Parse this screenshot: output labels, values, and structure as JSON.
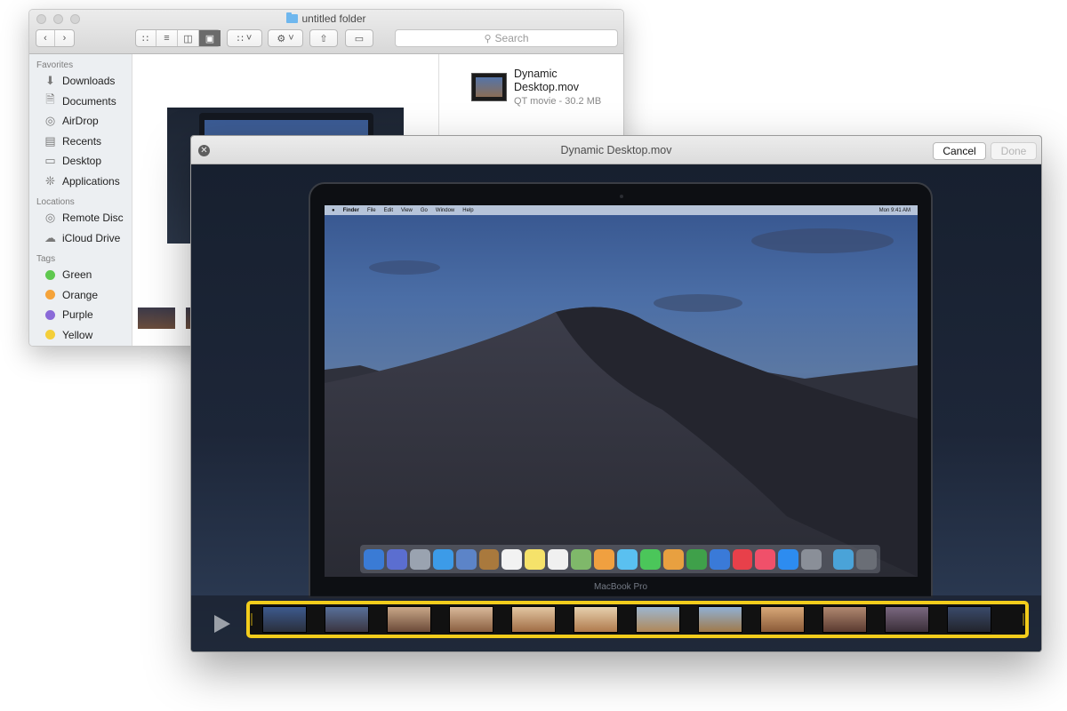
{
  "finder": {
    "title": "untitled folder",
    "search_placeholder": "Search",
    "sidebar": {
      "favorites_heading": "Favorites",
      "favorites": [
        {
          "label": "Downloads",
          "icon": "downloads-icon"
        },
        {
          "label": "Documents",
          "icon": "documents-icon"
        },
        {
          "label": "AirDrop",
          "icon": "airdrop-icon"
        },
        {
          "label": "Recents",
          "icon": "recents-icon"
        },
        {
          "label": "Desktop",
          "icon": "desktop-icon"
        },
        {
          "label": "Applications",
          "icon": "applications-icon"
        }
      ],
      "locations_heading": "Locations",
      "locations": [
        {
          "label": "Remote Disc",
          "icon": "disc-icon"
        },
        {
          "label": "iCloud Drive",
          "icon": "cloud-icon"
        }
      ],
      "tags_heading": "Tags",
      "tags": [
        {
          "label": "Green",
          "color": "#5fc84f"
        },
        {
          "label": "Orange",
          "color": "#f5a33a"
        },
        {
          "label": "Purple",
          "color": "#8a6ad8"
        },
        {
          "label": "Yellow",
          "color": "#f4cf3a"
        }
      ]
    },
    "info": {
      "name": "Dynamic Desktop.mov",
      "subtitle": "QT movie - 30.2 MB"
    }
  },
  "quicklook": {
    "title": "Dynamic Desktop.mov",
    "cancel_label": "Cancel",
    "done_label": "Done",
    "device_label": "MacBook Pro",
    "menubar": {
      "items": [
        "Finder",
        "File",
        "Edit",
        "View",
        "Go",
        "Window",
        "Help"
      ],
      "clock": "Mon 9:41 AM"
    },
    "trim_color": "#f3cd1c",
    "frame_count": 12
  },
  "colors": {
    "accent_trim": "#f3cd1c"
  }
}
